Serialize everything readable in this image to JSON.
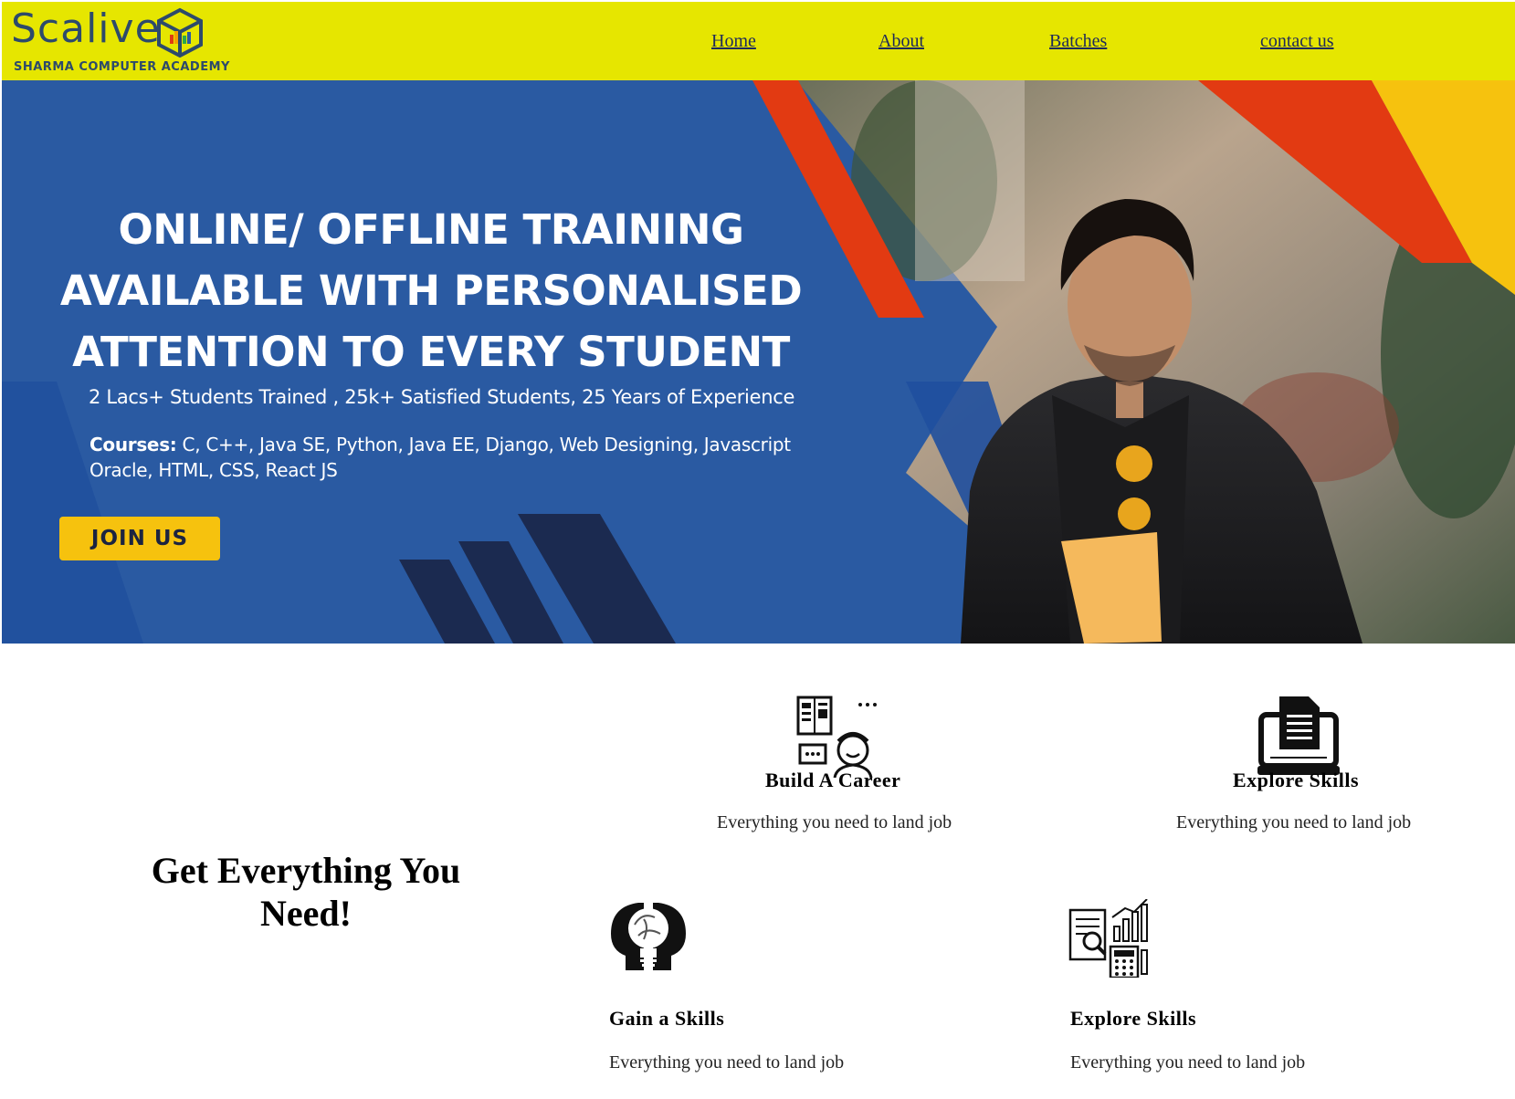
{
  "header": {
    "logo_word": "Scalive",
    "logo_tagline": "SHARMA COMPUTER ACADEMY",
    "nav": [
      {
        "label": "Home"
      },
      {
        "label": "About"
      },
      {
        "label": "Batches"
      },
      {
        "label": "contact us"
      }
    ]
  },
  "hero": {
    "title_lines": [
      "ONLINE/ OFFLINE TRAINING",
      "AVAILABLE WITH PERSONALISED",
      "ATTENTION TO EVERY STUDENT"
    ],
    "stats": "2 Lacs+ Students Trained , 25k+ Satisfied Students, 25 Years of Experience",
    "courses_label": "Courses:",
    "courses_text": " C, C++, Java SE, Python, Java EE, Django, Web Designing, Javascript Oracle, HTML, CSS, React JS",
    "cta": "JOIN US"
  },
  "features": {
    "heading": "Get Everything You Need!",
    "items": [
      {
        "title": "Build A Career",
        "desc": "Everything you need to land job",
        "icon": "career-icon"
      },
      {
        "title": "Explore Skills",
        "desc": "Everything you need to land job",
        "icon": "programming-laptop-icon"
      },
      {
        "title": "Gain a Skills",
        "desc": "Everything you need to land job",
        "icon": "brain-bulb-icon"
      },
      {
        "title": "Explore Skills",
        "desc": "Everything you need to land job",
        "icon": "analytics-icon"
      }
    ]
  },
  "colors": {
    "header_bg": "#e6e600",
    "hero_blue": "#2a5aa2",
    "accent_red": "#e23a12",
    "accent_yellow": "#f6c20e",
    "navy": "#1f2b5a"
  }
}
